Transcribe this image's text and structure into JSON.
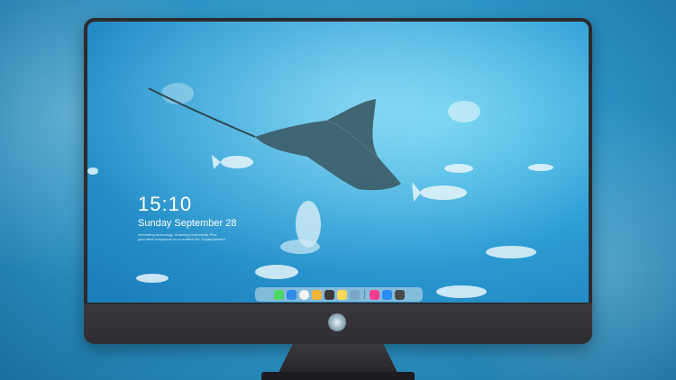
{
  "lockscreen": {
    "time": "15:10",
    "date": "Sunday September 28",
    "fine_print_line1": "Interesting technology. Amazing productivity. Plus",
    "fine_print_line2": "your ideal companion for a creative life. Superpowered"
  },
  "dock": {
    "icons": [
      {
        "name": "messages-icon",
        "color": "#4cd964"
      },
      {
        "name": "finder-icon",
        "color": "#2f8ce6"
      },
      {
        "name": "clock-icon",
        "color": "#f2f2f2"
      },
      {
        "name": "photos-icon",
        "color": "#f0b437"
      },
      {
        "name": "clapper-icon",
        "color": "#3b3b3b"
      },
      {
        "name": "notes-icon",
        "color": "#ffd95a"
      },
      {
        "name": "preview-icon",
        "color": "#7ba6c9"
      },
      {
        "name": "music-icon",
        "color": "#fc3c8d"
      },
      {
        "name": "app-store-icon",
        "color": "#2a8cf0"
      },
      {
        "name": "camera-icon",
        "color": "#4a4a4a"
      }
    ]
  },
  "colors": {
    "bezel": "#2b2a2f",
    "screen_water": "#2fa0d6"
  }
}
